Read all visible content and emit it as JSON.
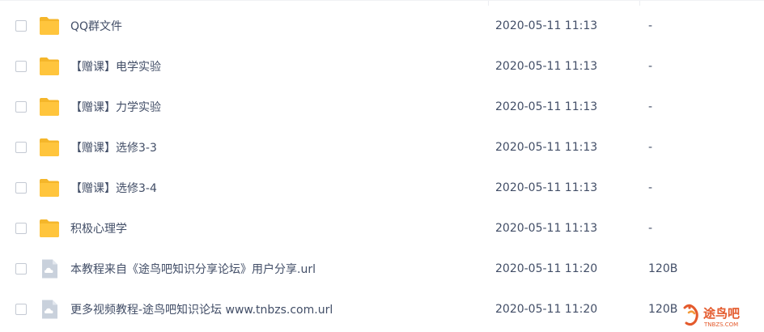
{
  "files": [
    {
      "name": "QQ群文件",
      "time": "2020-05-11 11:13",
      "size": "-",
      "icon": "folder-icon"
    },
    {
      "name": "【赠课】电学实验",
      "time": "2020-05-11 11:13",
      "size": "-",
      "icon": "folder-icon"
    },
    {
      "name": "【赠课】力学实验",
      "time": "2020-05-11 11:13",
      "size": "-",
      "icon": "folder-icon"
    },
    {
      "name": "【赠课】选修3-3",
      "time": "2020-05-11 11:13",
      "size": "-",
      "icon": "folder-icon"
    },
    {
      "name": "【赠课】选修3-4",
      "time": "2020-05-11 11:13",
      "size": "-",
      "icon": "folder-icon"
    },
    {
      "name": "积极心理学",
      "time": "2020-05-11 11:13",
      "size": "-",
      "icon": "folder-icon"
    },
    {
      "name": "本教程来自《途鸟吧知识分享论坛》用户分享.url",
      "time": "2020-05-11 11:20",
      "size": "120B",
      "icon": "url-file-icon"
    },
    {
      "name": "更多视频教程-途鸟吧知识论坛 www.tnbzs.com.url",
      "time": "2020-05-11 11:20",
      "size": "120B",
      "icon": "url-file-icon"
    }
  ],
  "watermark": {
    "text": "途鸟吧",
    "subtext": "TNBZS.COM"
  },
  "colors": {
    "folder": "#ffc53d",
    "folder_back": "#f5b62a",
    "url_file": "#c9d1dc",
    "text": "#424e67",
    "watermark": "#e45a2c"
  }
}
